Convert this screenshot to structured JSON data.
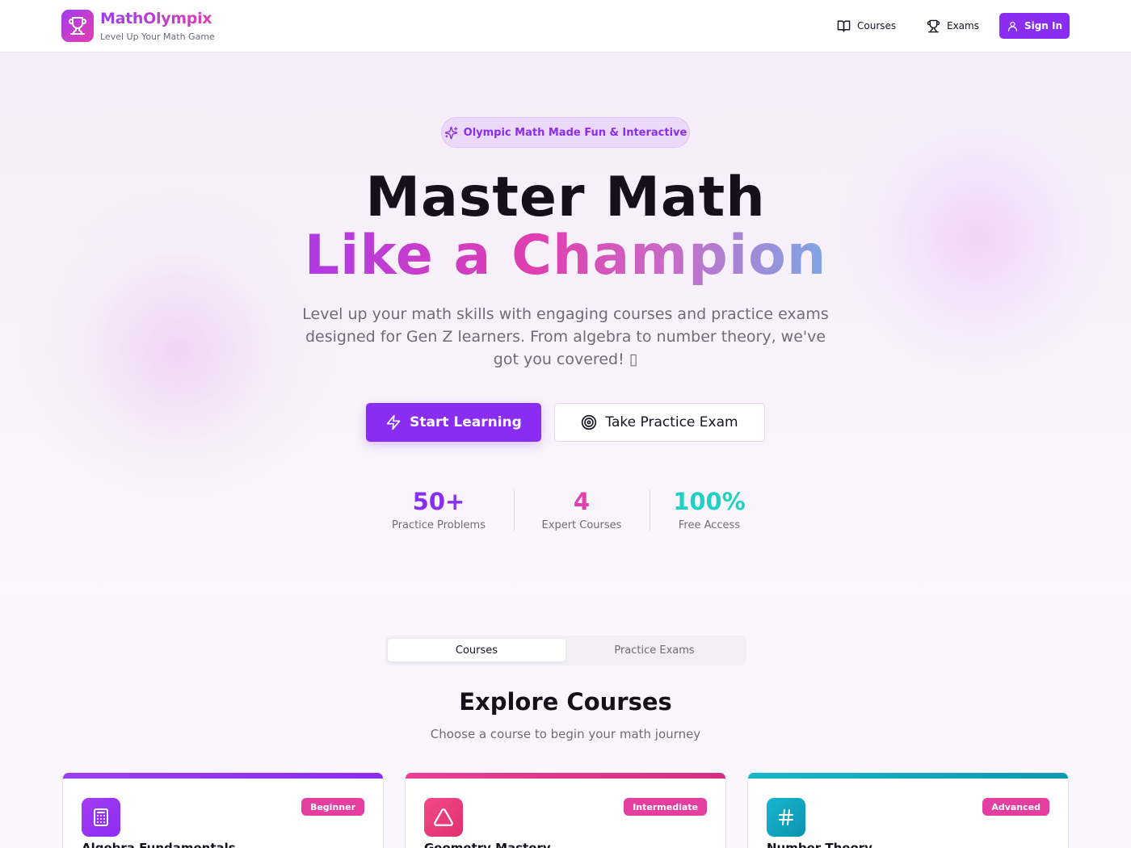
{
  "header": {
    "brand_name": "MathOlympix",
    "brand_tagline": "Level Up Your Math Game",
    "nav": [
      {
        "label": "Courses",
        "icon": "book-open-icon"
      },
      {
        "label": "Exams",
        "icon": "trophy-icon"
      }
    ],
    "signin_label": "Sign In"
  },
  "hero": {
    "pill_text": "Olympic Math Made Fun & Interactive",
    "headline_line1": "Master Math",
    "headline_line2": "Like a Champion",
    "subtitle": "Level up your math skills with engaging courses and practice exams designed for Gen Z learners. From algebra to number theory, we've got you covered! ▯",
    "primary_cta": "Start Learning",
    "secondary_cta": "Take Practice Exam",
    "stats": [
      {
        "value": "50+",
        "label": "Practice Problems"
      },
      {
        "value": "4",
        "label": "Expert Courses"
      },
      {
        "value": "100%",
        "label": "Free Access"
      }
    ]
  },
  "tabs": [
    {
      "label": "Courses",
      "active": true
    },
    {
      "label": "Practice Exams",
      "active": false
    }
  ],
  "section": {
    "title": "Explore Courses",
    "subtitle": "Choose a course to begin your math journey"
  },
  "courses": [
    {
      "title": "Algebra Fundamentals",
      "level": "Beginner",
      "icon": "calculator-icon",
      "color": "#8a2df2"
    },
    {
      "title": "Geometry Mastery",
      "level": "Intermediate",
      "icon": "triangle-icon",
      "color": "#e0306f"
    },
    {
      "title": "Number Theory",
      "level": "Advanced",
      "icon": "hash-icon",
      "color": "#0d93b0"
    }
  ],
  "colors": {
    "accent": "#8a2df2",
    "pink": "#e03fae",
    "teal": "#1fd1c5",
    "badge": "#e43fa0"
  }
}
